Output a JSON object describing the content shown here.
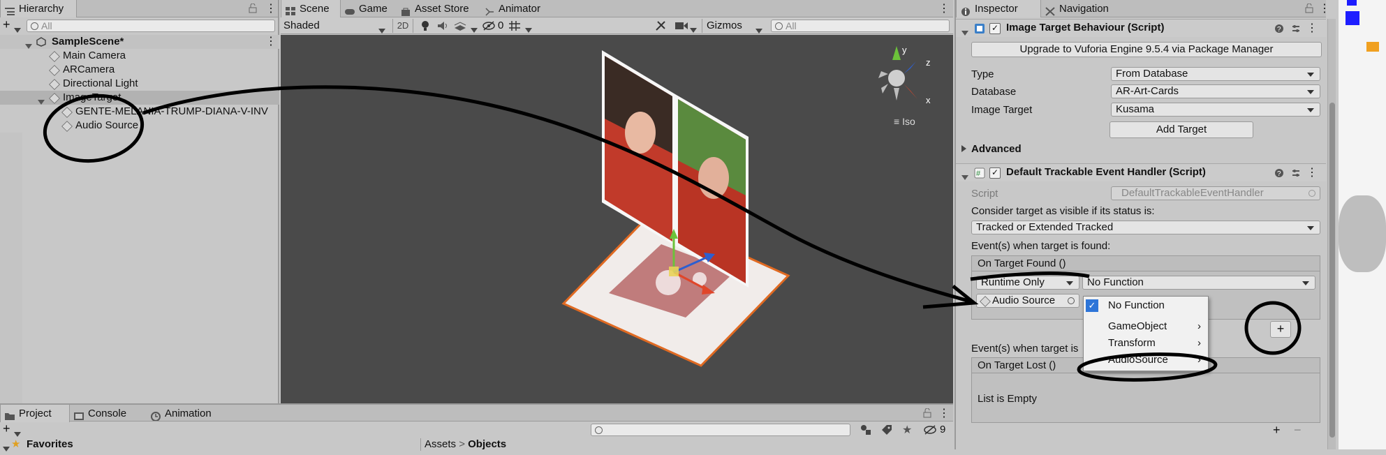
{
  "hierarchy": {
    "tab": "Hierarchy",
    "search_placeholder": "All",
    "scene": "SampleScene*",
    "items": [
      "Main Camera",
      "ARCamera",
      "Directional Light",
      "ImageTarget",
      "GENTE-MELANIA-TRUMP-DIANA-V-INV",
      "Audio Source"
    ]
  },
  "scene_view": {
    "tabs": [
      "Scene",
      "Game",
      "Asset Store",
      "Animator"
    ],
    "shading": "Shaded",
    "mode_2d": "2D",
    "hidden_count": "0",
    "gizmos": "Gizmos",
    "search_placeholder": "All",
    "projection": "Iso",
    "axis_labels": {
      "x": "x",
      "y": "y",
      "z": "z"
    }
  },
  "inspector": {
    "tabs": [
      "Inspector",
      "Navigation"
    ],
    "image_target": {
      "title": "Image Target Behaviour (Script)",
      "upgrade_button": "Upgrade to Vuforia Engine 9.5.4 via Package Manager",
      "type_label": "Type",
      "type_value": "From Database",
      "database_label": "Database",
      "database_value": "AR-Art-Cards",
      "image_target_label": "Image Target",
      "image_target_value": "Kusama",
      "add_target_button": "Add Target",
      "advanced": "Advanced"
    },
    "event_handler": {
      "title": "Default Trackable Event Handler (Script)",
      "script_label": "Script",
      "script_value": "DefaultTrackableEventHandler",
      "consider_label": "Consider target as visible if its status is:",
      "status_value": "Tracked or Extended Tracked",
      "found_label": "Event(s) when target is found:",
      "found_event": "On Target Found ()",
      "runtime_value": "Runtime Only",
      "function_value": "No Function",
      "object_value": "Audio Source",
      "lost_label": "Event(s) when target is",
      "lost_event": "On Target Lost ()",
      "empty_list": "List is Empty",
      "plus": "+",
      "minus": "−"
    }
  },
  "function_menu": {
    "items": [
      {
        "label": "No Function",
        "checked": true,
        "submenu": false
      },
      {
        "label": "GameObject",
        "checked": false,
        "submenu": true
      },
      {
        "label": "Transform",
        "checked": false,
        "submenu": true
      },
      {
        "label": "AudioSource",
        "checked": false,
        "submenu": true
      }
    ],
    "submenu_glyph": "›",
    "check_glyph": "✓"
  },
  "project": {
    "tabs": [
      "Project",
      "Console",
      "Animation"
    ],
    "favorites": "Favorites",
    "breadcrumb_root": "Assets",
    "breadcrumb_sep": ">",
    "breadcrumb_current": "Objects",
    "hidden_count": "9",
    "add": "+"
  }
}
